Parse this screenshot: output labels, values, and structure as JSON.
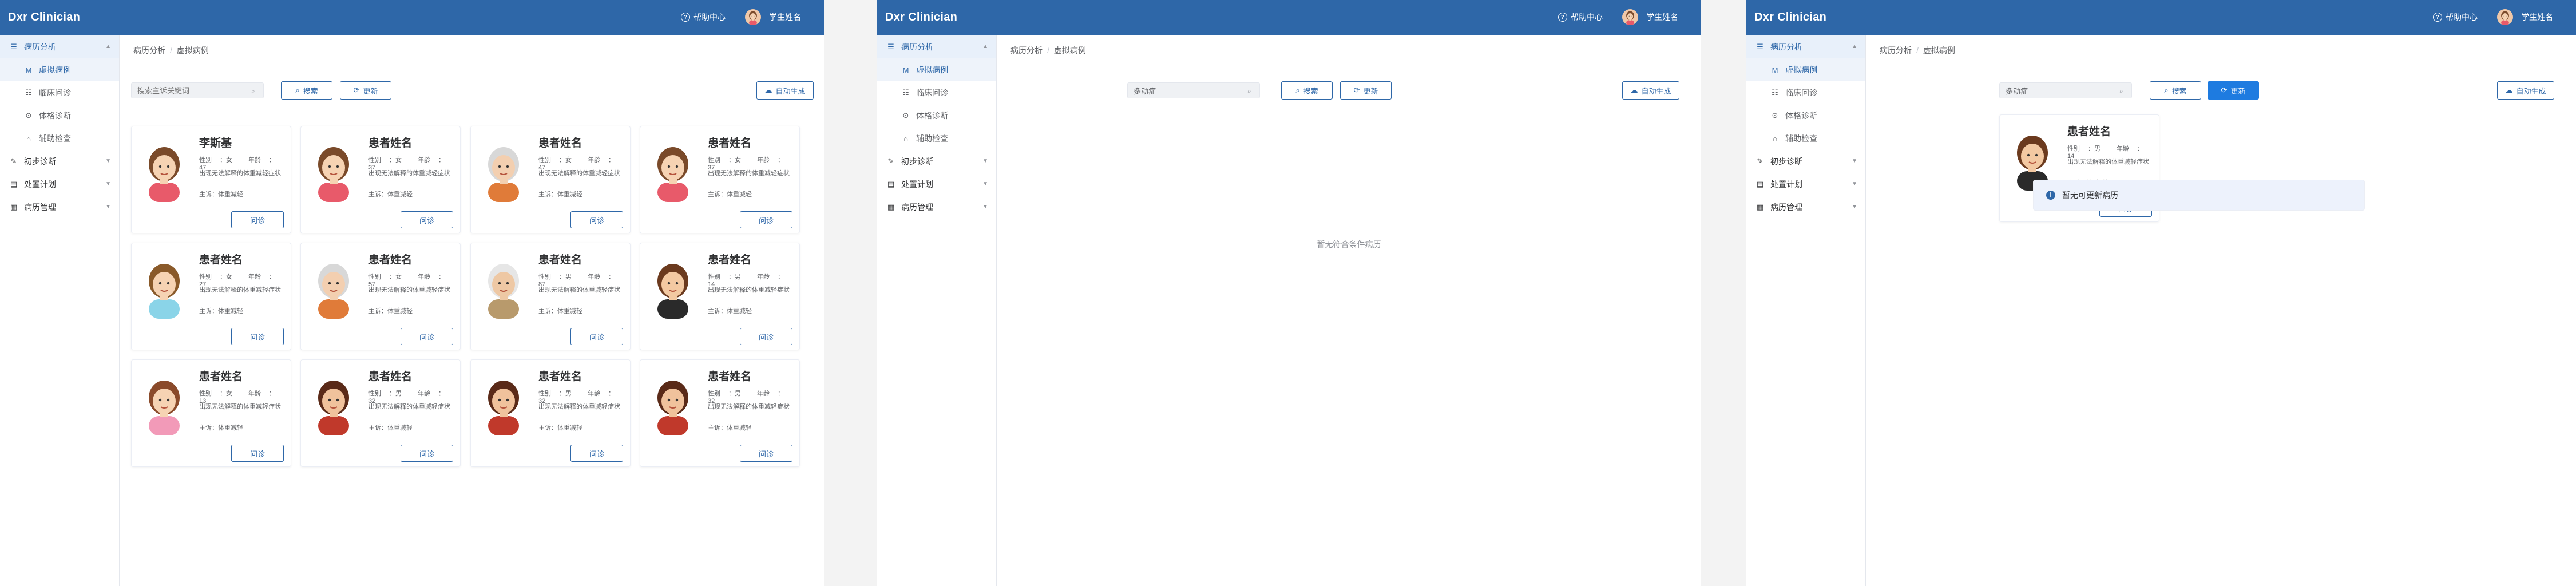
{
  "app": {
    "brand": "Dxr Clinician",
    "help": "帮助中心",
    "user": "学生姓名"
  },
  "menu": {
    "case_analysis": "病历分析",
    "virtual_case": "虚拟病例",
    "clinical_inquiry": "临床问诊",
    "physical_exam": "体格诊断",
    "aux_exam": "辅助检查",
    "initial_diagnosis": "初步诊断",
    "treatment_plan": "处置计划",
    "ward_management": "病历管理"
  },
  "breadcrumb": [
    "病历分析",
    "虚拟病例"
  ],
  "toolbar": {
    "search_placeholder": "搜索主诉关键词",
    "search_label": "搜索",
    "refresh_label": "更新",
    "auto_label": "自动生成"
  },
  "labels": {
    "gender": "性别",
    "age": "年龄",
    "desc_prefix": "",
    "complaint": "主诉"
  },
  "screen1": {
    "cards": [
      {
        "name": "李斯基",
        "gender": "女",
        "age": "47",
        "desc": "出现无法解释的体重减轻症状",
        "complaint": "主诉：体重减轻",
        "button": "问诊"
      },
      {
        "name": "患者姓名",
        "gender": "女",
        "age": "37",
        "desc": "出现无法解释的体重减轻症状",
        "complaint": "主诉：体重减轻",
        "button": "问诊"
      },
      {
        "name": "患者姓名",
        "gender": "女",
        "age": "47",
        "desc": "出现无法解释的体重减轻症状",
        "complaint": "主诉：体重减轻",
        "button": "问诊"
      },
      {
        "name": "患者姓名",
        "gender": "女",
        "age": "37",
        "desc": "出现无法解释的体重减轻症状",
        "complaint": "主诉：体重减轻",
        "button": "问诊"
      },
      {
        "name": "患者姓名",
        "gender": "女",
        "age": "27",
        "desc": "出现无法解释的体重减轻症状",
        "complaint": "主诉：体重减轻",
        "button": "问诊"
      },
      {
        "name": "患者姓名",
        "gender": "女",
        "age": "57",
        "desc": "出现无法解释的体重减轻症状",
        "complaint": "主诉：体重减轻",
        "button": "问诊"
      },
      {
        "name": "患者姓名",
        "gender": "男",
        "age": "87",
        "desc": "出现无法解释的体重减轻症状",
        "complaint": "主诉：体重减轻",
        "button": "问诊"
      },
      {
        "name": "患者姓名",
        "gender": "男",
        "age": "14",
        "desc": "出现无法解释的体重减轻症状",
        "complaint": "主诉：体重减轻",
        "button": "问诊"
      },
      {
        "name": "患者姓名",
        "gender": "女",
        "age": "13",
        "desc": "出现无法解释的体重减轻症状",
        "complaint": "主诉：体重减轻",
        "button": "问诊"
      },
      {
        "name": "患者姓名",
        "gender": "男",
        "age": "32",
        "desc": "出现无法解释的体重减轻症状",
        "complaint": "主诉：体重减轻",
        "button": "问诊"
      },
      {
        "name": "患者姓名",
        "gender": "男",
        "age": "32",
        "desc": "出现无法解释的体重减轻症状",
        "complaint": "主诉：体重减轻",
        "button": "问诊"
      },
      {
        "name": "患者姓名",
        "gender": "男",
        "age": "32",
        "desc": "出现无法解释的体重减轻症状",
        "complaint": "主诉：体重减轻",
        "button": "问诊"
      }
    ]
  },
  "screen2": {
    "search_value": "多动症",
    "empty_text": "暂无符合条件病历"
  },
  "screen3": {
    "search_value": "多动症",
    "card": {
      "name": "患者姓名",
      "gender": "男",
      "age": "14",
      "desc": "出现无法解释的体重减轻症状",
      "complaint": "主诉：体重减轻",
      "button": "问诊"
    },
    "toast": "暂无可更新病历"
  },
  "colors": {
    "header": "#2e67a8",
    "primary": "#1e7be0",
    "active_bg": "#e8f0fa"
  }
}
